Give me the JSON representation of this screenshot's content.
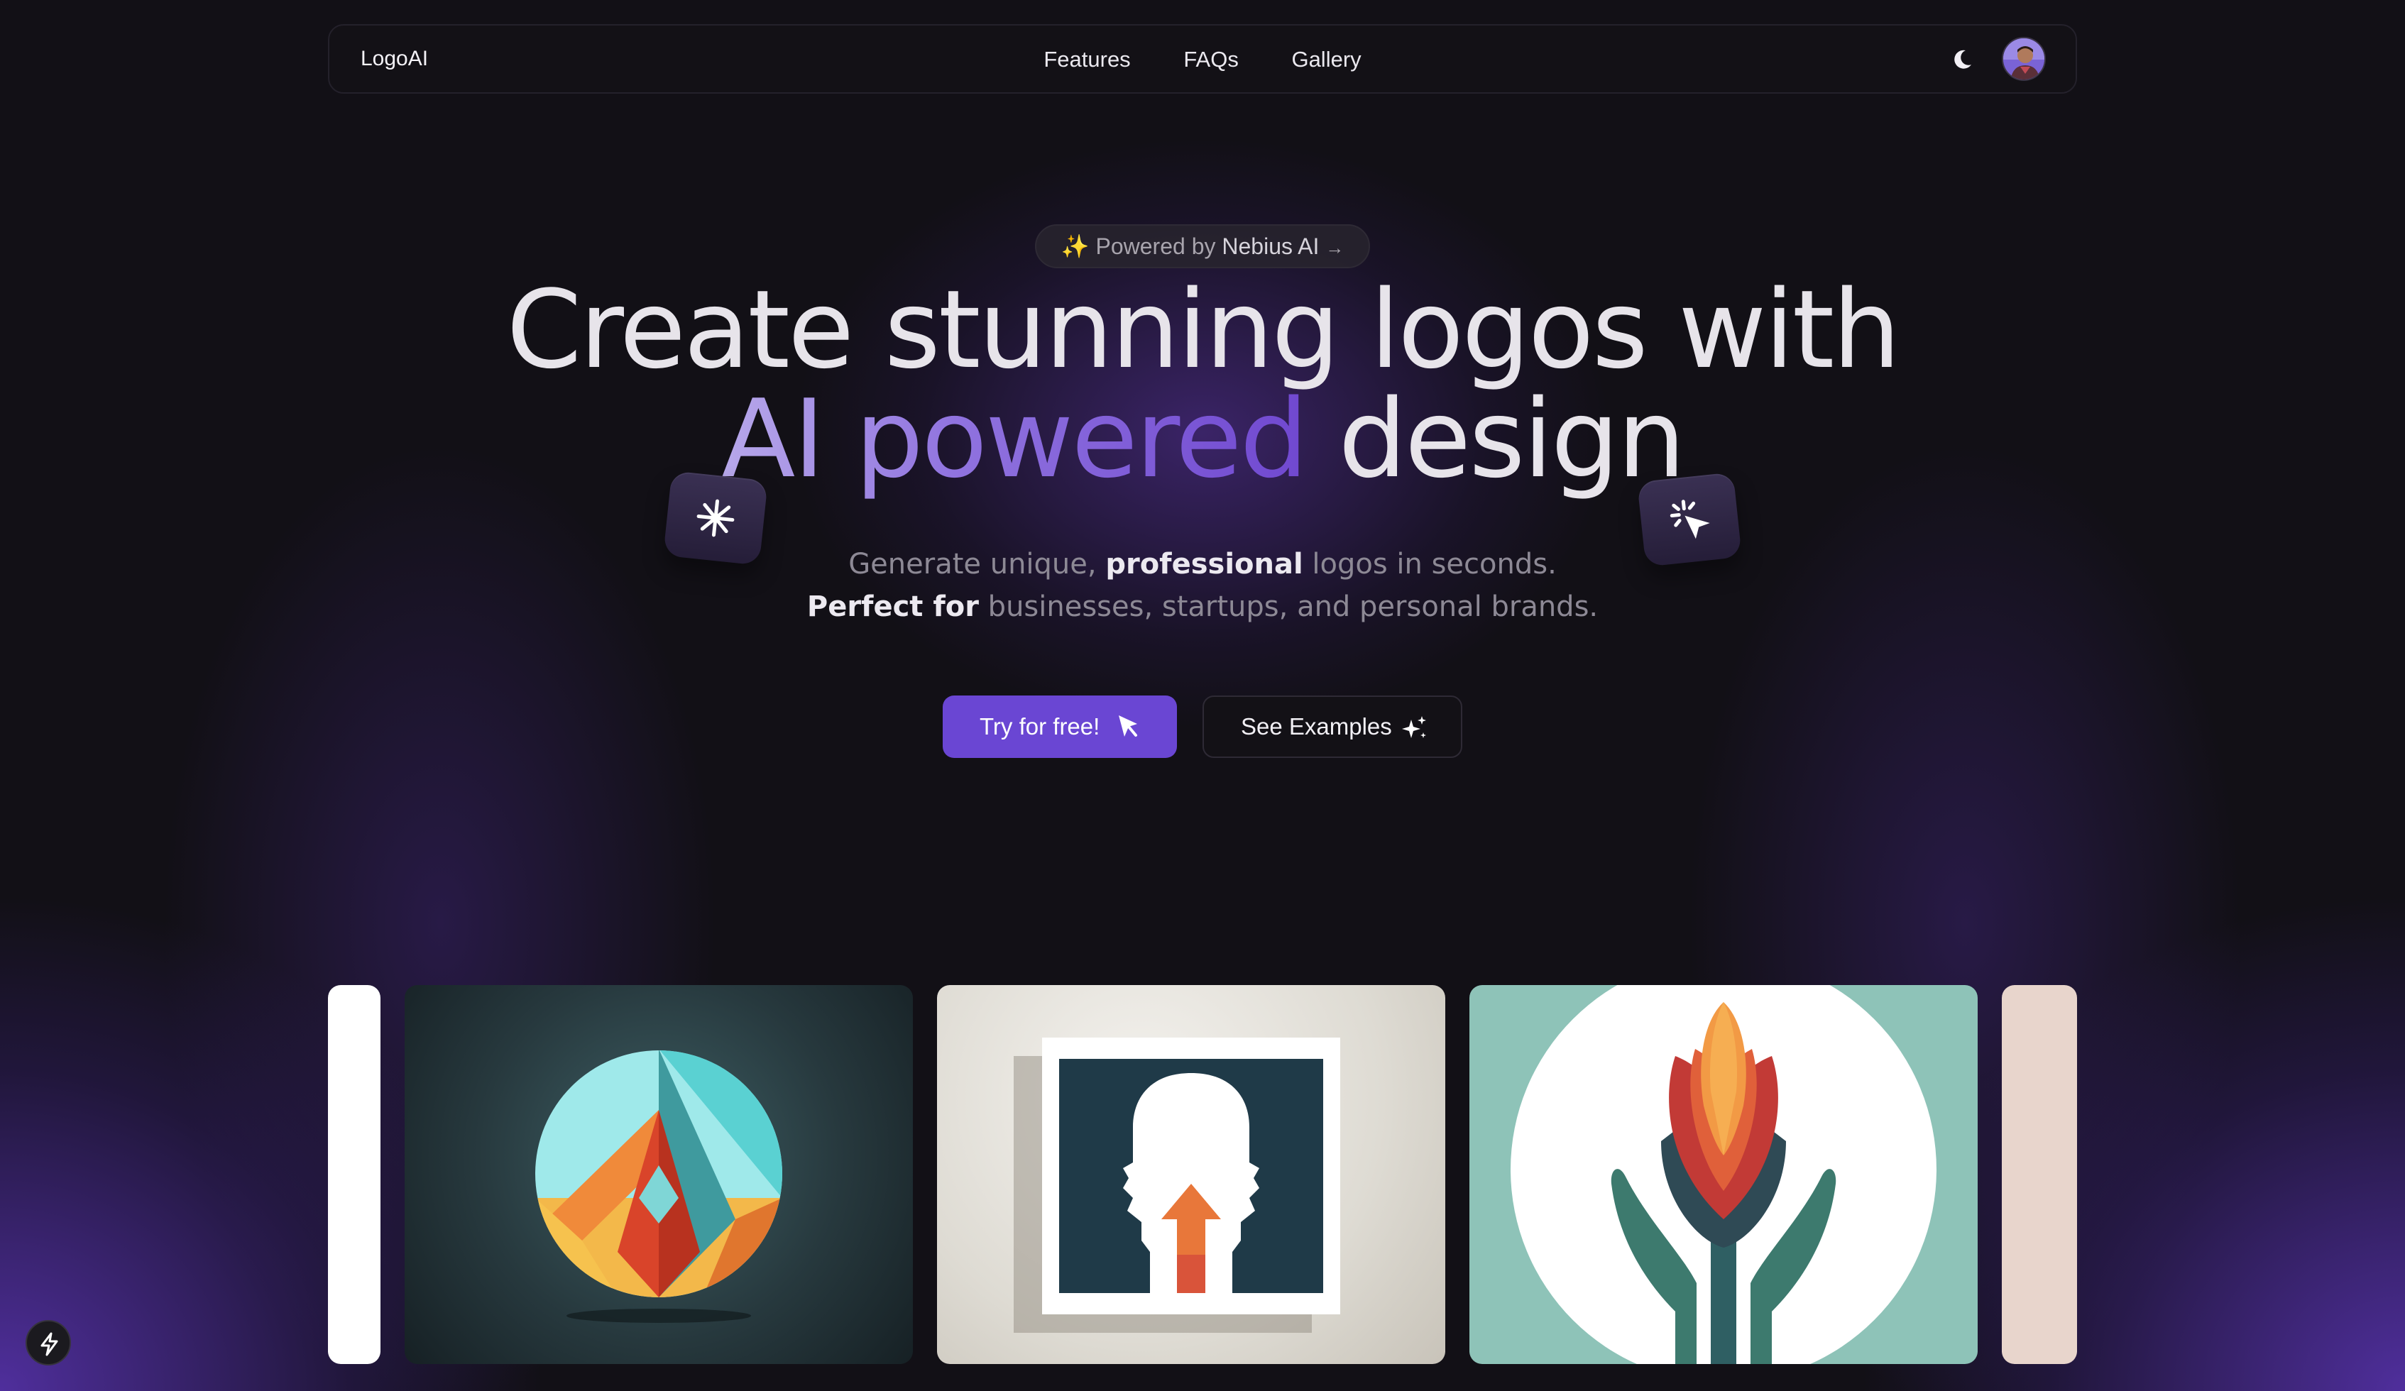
{
  "nav": {
    "brand": "LogoAI",
    "links": [
      "Features",
      "FAQs",
      "Gallery"
    ],
    "theme_icon": "moon-icon",
    "avatar_icon": "user-avatar"
  },
  "hero": {
    "badge": {
      "sparkle": "✨",
      "prefix": "Powered by",
      "name": "Nebius AI",
      "arrow": "→"
    },
    "headline_line1": "Create stunning logos with",
    "headline_line2_highlight": "AI powered",
    "headline_line2_rest": "design",
    "subtitle_line1": {
      "a": "Generate unique,",
      "b": "professional",
      "c": "logos in seconds."
    },
    "subtitle_line2": {
      "a": "Perfect for",
      "b": "businesses, startups, and personal brands."
    },
    "primary_button": "Try for free!",
    "secondary_button": "See Examples",
    "float_icons": [
      "asterisk-icon",
      "click-sparkle-icon"
    ]
  },
  "gallery": {
    "cards": [
      "mountain-circle-logo",
      "head-arrow-logo",
      "flower-hands-logo"
    ]
  },
  "colors": {
    "background": "#121016",
    "accent": "#6a46d3",
    "gradient_text_start": "#b7a8ea",
    "gradient_text_end": "#7048d0"
  }
}
